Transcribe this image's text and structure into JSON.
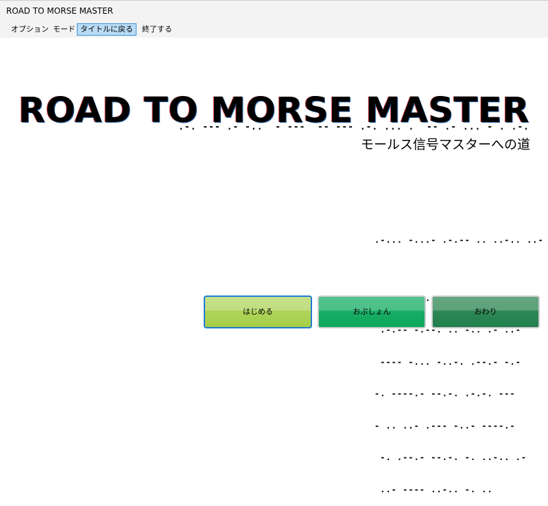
{
  "window": {
    "title": "ROAD TO MORSE MASTER"
  },
  "menu": {
    "items": [
      {
        "label": "オプション"
      },
      {
        "label": "モード"
      },
      {
        "label": "タイトルに戻る",
        "active": true
      },
      {
        "label": "終了する"
      }
    ]
  },
  "main": {
    "title": "ROAD TO MORSE MASTER",
    "title_morse": ".-. --- .- -..  - ---  -- --- .-. ... .  -- .- ... - . .-.",
    "subtitle": "モールス信号マスターへの道",
    "morse_lines": [
      ".-... -...- .-.-- .. ..-.. ..-",
      "---- --- .-.. .. -- -...-",
      " .-.-- -.--. .. -.. .- ..-",
      " ---- -... -..-. .--.- -.-",
      "-. ----.- --.-. .-.-. ---",
      "- .. ..- .--- -..- ----.-",
      " -. .--.- --.-. -. ..-.. .-",
      " ..- ---- ..-.. -. .."
    ]
  },
  "buttons": {
    "start": "はじめる",
    "options": "おぷしょん",
    "quit": "おわり"
  },
  "colors": {
    "start": "#a9cf4f",
    "options": "#10a85d",
    "quit": "#268152"
  }
}
